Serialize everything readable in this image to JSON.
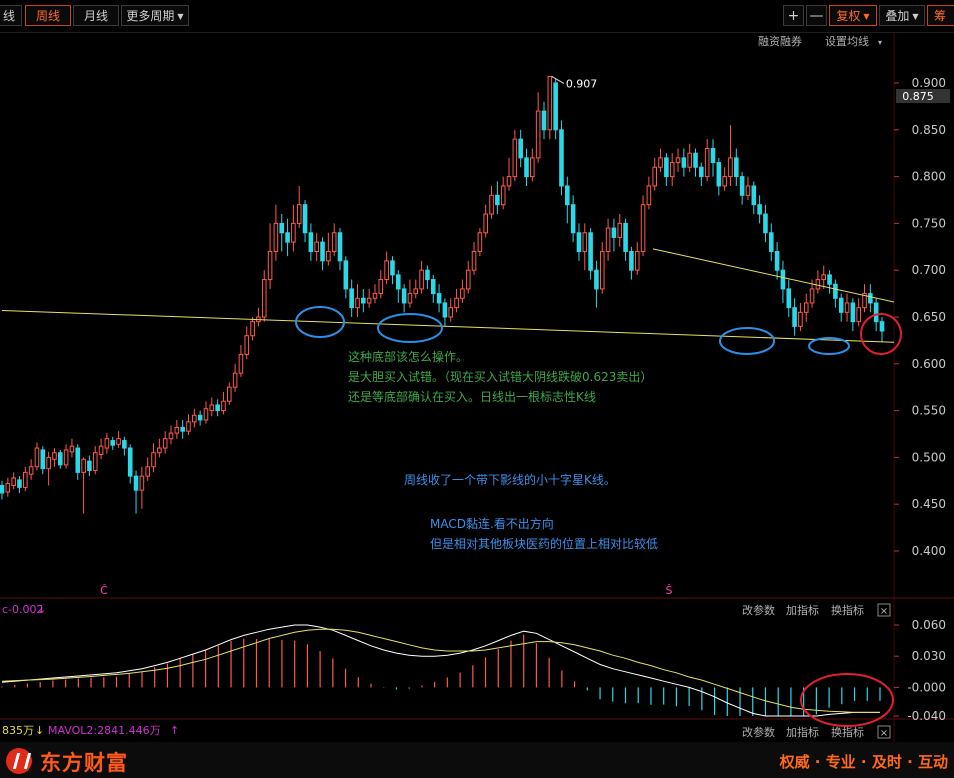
{
  "toolbar": {
    "cut_tab": "线",
    "tabs": [
      {
        "label": "周线",
        "active": true
      },
      {
        "label": "月线",
        "active": false
      },
      {
        "label": "更多周期",
        "active": false
      }
    ],
    "zoom_in": "+",
    "zoom_out": "—",
    "fuquan": "复权",
    "overlay": "叠加",
    "cut_right": "筹码"
  },
  "main_panel": {
    "links": [
      "融资融券",
      "设置均线"
    ],
    "current_price": "0.875",
    "price_ticks": [
      "0.900",
      "0.850",
      "0.800",
      "0.750",
      "0.700",
      "0.650",
      "0.600",
      "0.550",
      "0.500",
      "0.450",
      "0.400"
    ],
    "high_label": "0.907",
    "markers": [
      "Ĉ",
      "Ŝ"
    ],
    "annotations": [
      "这种底部该怎么操作。",
      "是大胆买入试错。（现在买入试错大阴线跌破0.623卖出）",
      "还是等底部确认在买入。日线出一根标志性K线",
      "周线收了一个带下影线的小十字星K线。",
      "MACD黏连.看不出方向",
      "但是相对其他板块医药的位置上相对比较低"
    ]
  },
  "macd_panel": {
    "label": "c-0.002",
    "links": [
      "改参数",
      "加指标",
      "换指标"
    ],
    "ticks": [
      "0.060",
      "0.030",
      "-0.000",
      "-0.040"
    ]
  },
  "vol_panel": {
    "label1": "835万",
    "label2": "MAVOL2:2841.446万",
    "links": [
      "改参数",
      "加指标",
      "换指标"
    ]
  },
  "brand": {
    "name": "东方财富",
    "slogan": "权威 · 专业 · 及时 · 互动"
  },
  "chart_data": {
    "type": "candlestick",
    "timeframe": "weekly",
    "ylim": [
      0.36,
      0.925
    ],
    "high_mark": 0.907,
    "current_price": 0.875,
    "candles": [
      [
        0.47,
        0.462,
        0.475,
        0.455
      ],
      [
        0.463,
        0.472,
        0.478,
        0.458
      ],
      [
        0.47,
        0.478,
        0.484,
        0.466
      ],
      [
        0.476,
        0.468,
        0.48,
        0.462
      ],
      [
        0.468,
        0.484,
        0.49,
        0.464
      ],
      [
        0.482,
        0.49,
        0.498,
        0.476
      ],
      [
        0.49,
        0.51,
        0.516,
        0.486
      ],
      [
        0.508,
        0.488,
        0.512,
        0.482
      ],
      [
        0.488,
        0.5,
        0.506,
        0.47
      ],
      [
        0.498,
        0.505,
        0.51,
        0.49
      ],
      [
        0.505,
        0.492,
        0.508,
        0.488
      ],
      [
        0.492,
        0.508,
        0.514,
        0.488
      ],
      [
        0.506,
        0.512,
        0.52,
        0.5
      ],
      [
        0.51,
        0.484,
        0.514,
        0.476
      ],
      [
        0.484,
        0.498,
        0.5,
        0.44
      ],
      [
        0.496,
        0.486,
        0.502,
        0.48
      ],
      [
        0.486,
        0.505,
        0.512,
        0.482
      ],
      [
        0.503,
        0.512,
        0.52,
        0.498
      ],
      [
        0.51,
        0.52,
        0.526,
        0.504
      ],
      [
        0.518,
        0.513,
        0.522,
        0.508
      ],
      [
        0.514,
        0.52,
        0.528,
        0.51
      ],
      [
        0.518,
        0.51,
        0.522,
        0.502
      ],
      [
        0.51,
        0.48,
        0.514,
        0.472
      ],
      [
        0.48,
        0.465,
        0.486,
        0.44
      ],
      [
        0.465,
        0.48,
        0.49,
        0.445
      ],
      [
        0.48,
        0.49,
        0.5,
        0.475
      ],
      [
        0.49,
        0.505,
        0.515,
        0.484
      ],
      [
        0.505,
        0.51,
        0.52,
        0.5
      ],
      [
        0.51,
        0.52,
        0.528,
        0.504
      ],
      [
        0.52,
        0.526,
        0.534,
        0.514
      ],
      [
        0.526,
        0.532,
        0.54,
        0.52
      ],
      [
        0.532,
        0.528,
        0.54,
        0.52
      ],
      [
        0.528,
        0.538,
        0.546,
        0.524
      ],
      [
        0.538,
        0.545,
        0.552,
        0.532
      ],
      [
        0.545,
        0.54,
        0.55,
        0.534
      ],
      [
        0.54,
        0.552,
        0.56,
        0.536
      ],
      [
        0.55,
        0.556,
        0.564,
        0.544
      ],
      [
        0.556,
        0.55,
        0.562,
        0.544
      ],
      [
        0.55,
        0.56,
        0.57,
        0.546
      ],
      [
        0.56,
        0.575,
        0.58,
        0.556
      ],
      [
        0.575,
        0.59,
        0.6,
        0.57
      ],
      [
        0.59,
        0.61,
        0.62,
        0.586
      ],
      [
        0.61,
        0.63,
        0.64,
        0.605
      ],
      [
        0.63,
        0.645,
        0.65,
        0.625
      ],
      [
        0.645,
        0.65,
        0.66,
        0.64
      ],
      [
        0.65,
        0.69,
        0.7,
        0.645
      ],
      [
        0.69,
        0.72,
        0.75,
        0.68
      ],
      [
        0.72,
        0.75,
        0.77,
        0.71
      ],
      [
        0.75,
        0.74,
        0.76,
        0.72
      ],
      [
        0.74,
        0.73,
        0.755,
        0.715
      ],
      [
        0.73,
        0.75,
        0.77,
        0.72
      ],
      [
        0.75,
        0.77,
        0.79,
        0.745
      ],
      [
        0.77,
        0.74,
        0.775,
        0.73
      ],
      [
        0.74,
        0.72,
        0.75,
        0.71
      ],
      [
        0.72,
        0.73,
        0.74,
        0.71
      ],
      [
        0.73,
        0.71,
        0.735,
        0.7
      ],
      [
        0.71,
        0.72,
        0.74,
        0.705
      ],
      [
        0.72,
        0.74,
        0.75,
        0.715
      ],
      [
        0.74,
        0.71,
        0.745,
        0.7
      ],
      [
        0.71,
        0.68,
        0.715,
        0.67
      ],
      [
        0.68,
        0.66,
        0.69,
        0.65
      ],
      [
        0.66,
        0.67,
        0.685,
        0.65
      ],
      [
        0.67,
        0.665,
        0.68,
        0.655
      ],
      [
        0.665,
        0.67,
        0.68,
        0.66
      ],
      [
        0.67,
        0.675,
        0.685,
        0.665
      ],
      [
        0.675,
        0.69,
        0.7,
        0.67
      ],
      [
        0.69,
        0.71,
        0.72,
        0.685
      ],
      [
        0.71,
        0.695,
        0.715,
        0.685
      ],
      [
        0.695,
        0.68,
        0.7,
        0.665
      ],
      [
        0.68,
        0.665,
        0.685,
        0.655
      ],
      [
        0.665,
        0.675,
        0.69,
        0.66
      ],
      [
        0.675,
        0.68,
        0.69,
        0.67
      ],
      [
        0.68,
        0.7,
        0.71,
        0.675
      ],
      [
        0.7,
        0.69,
        0.705,
        0.68
      ],
      [
        0.69,
        0.675,
        0.695,
        0.665
      ],
      [
        0.675,
        0.665,
        0.685,
        0.655
      ],
      [
        0.665,
        0.65,
        0.67,
        0.64
      ],
      [
        0.65,
        0.66,
        0.67,
        0.645
      ],
      [
        0.66,
        0.67,
        0.68,
        0.655
      ],
      [
        0.67,
        0.68,
        0.69,
        0.665
      ],
      [
        0.68,
        0.7,
        0.71,
        0.675
      ],
      [
        0.7,
        0.72,
        0.73,
        0.695
      ],
      [
        0.72,
        0.74,
        0.745,
        0.715
      ],
      [
        0.74,
        0.76,
        0.77,
        0.735
      ],
      [
        0.76,
        0.78,
        0.79,
        0.755
      ],
      [
        0.78,
        0.77,
        0.795,
        0.76
      ],
      [
        0.77,
        0.79,
        0.8,
        0.765
      ],
      [
        0.79,
        0.8,
        0.82,
        0.785
      ],
      [
        0.8,
        0.84,
        0.85,
        0.795
      ],
      [
        0.84,
        0.82,
        0.85,
        0.81
      ],
      [
        0.82,
        0.8,
        0.83,
        0.79
      ],
      [
        0.8,
        0.82,
        0.83,
        0.795
      ],
      [
        0.82,
        0.87,
        0.89,
        0.815
      ],
      [
        0.87,
        0.85,
        0.88,
        0.84
      ],
      [
        0.85,
        0.907,
        0.907,
        0.84
      ],
      [
        0.9,
        0.85,
        0.905,
        0.84
      ],
      [
        0.85,
        0.79,
        0.86,
        0.78
      ],
      [
        0.79,
        0.77,
        0.8,
        0.75
      ],
      [
        0.77,
        0.74,
        0.78,
        0.73
      ],
      [
        0.74,
        0.72,
        0.75,
        0.71
      ],
      [
        0.72,
        0.74,
        0.75,
        0.7
      ],
      [
        0.74,
        0.7,
        0.745,
        0.69
      ],
      [
        0.7,
        0.68,
        0.71,
        0.66
      ],
      [
        0.68,
        0.72,
        0.73,
        0.675
      ],
      [
        0.72,
        0.745,
        0.755,
        0.71
      ],
      [
        0.745,
        0.735,
        0.755,
        0.72
      ],
      [
        0.735,
        0.75,
        0.76,
        0.725
      ],
      [
        0.75,
        0.72,
        0.755,
        0.71
      ],
      [
        0.72,
        0.7,
        0.725,
        0.69
      ],
      [
        0.7,
        0.72,
        0.73,
        0.695
      ],
      [
        0.72,
        0.77,
        0.78,
        0.715
      ],
      [
        0.77,
        0.79,
        0.8,
        0.765
      ],
      [
        0.79,
        0.81,
        0.82,
        0.785
      ],
      [
        0.81,
        0.82,
        0.83,
        0.805
      ],
      [
        0.82,
        0.8,
        0.825,
        0.79
      ],
      [
        0.8,
        0.815,
        0.825,
        0.79
      ],
      [
        0.815,
        0.82,
        0.83,
        0.805
      ],
      [
        0.82,
        0.81,
        0.83,
        0.8
      ],
      [
        0.81,
        0.825,
        0.835,
        0.805
      ],
      [
        0.825,
        0.81,
        0.83,
        0.8
      ],
      [
        0.81,
        0.8,
        0.815,
        0.79
      ],
      [
        0.8,
        0.83,
        0.84,
        0.795
      ],
      [
        0.83,
        0.815,
        0.84,
        0.8
      ],
      [
        0.815,
        0.79,
        0.82,
        0.78
      ],
      [
        0.79,
        0.8,
        0.81,
        0.785
      ],
      [
        0.8,
        0.82,
        0.855,
        0.79
      ],
      [
        0.82,
        0.8,
        0.83,
        0.79
      ],
      [
        0.8,
        0.78,
        0.805,
        0.77
      ],
      [
        0.78,
        0.79,
        0.8,
        0.775
      ],
      [
        0.79,
        0.77,
        0.795,
        0.76
      ],
      [
        0.77,
        0.76,
        0.78,
        0.75
      ],
      [
        0.76,
        0.74,
        0.77,
        0.73
      ],
      [
        0.74,
        0.72,
        0.75,
        0.71
      ],
      [
        0.72,
        0.7,
        0.73,
        0.69
      ],
      [
        0.7,
        0.68,
        0.71,
        0.665
      ],
      [
        0.68,
        0.66,
        0.69,
        0.65
      ],
      [
        0.66,
        0.64,
        0.67,
        0.63
      ],
      [
        0.64,
        0.655,
        0.665,
        0.635
      ],
      [
        0.655,
        0.665,
        0.675,
        0.645
      ],
      [
        0.665,
        0.68,
        0.69,
        0.66
      ],
      [
        0.68,
        0.69,
        0.7,
        0.675
      ],
      [
        0.69,
        0.695,
        0.705,
        0.68
      ],
      [
        0.695,
        0.685,
        0.7,
        0.675
      ],
      [
        0.685,
        0.67,
        0.69,
        0.66
      ],
      [
        0.67,
        0.655,
        0.675,
        0.645
      ],
      [
        0.655,
        0.665,
        0.675,
        0.645
      ],
      [
        0.665,
        0.645,
        0.67,
        0.635
      ],
      [
        0.645,
        0.66,
        0.67,
        0.64
      ],
      [
        0.66,
        0.675,
        0.685,
        0.655
      ],
      [
        0.675,
        0.665,
        0.685,
        0.655
      ],
      [
        0.665,
        0.645,
        0.67,
        0.635
      ],
      [
        0.645,
        0.635,
        0.65,
        0.623
      ]
    ],
    "support_line": [
      [
        0,
        0.657
      ],
      [
        147,
        0.623
      ]
    ],
    "resistance_line": [
      [
        134,
        0.71
      ],
      [
        147,
        0.666
      ]
    ],
    "macd": {
      "ylim": [
        -0.05,
        0.07
      ],
      "dif": [
        0.005,
        0.006,
        0.007,
        0.008,
        0.009,
        0.01,
        0.011,
        0.012,
        0.013,
        0.014,
        0.016,
        0.018,
        0.021,
        0.024,
        0.028,
        0.032,
        0.036,
        0.041,
        0.046,
        0.05,
        0.053,
        0.056,
        0.058,
        0.06,
        0.06,
        0.058,
        0.055,
        0.05,
        0.045,
        0.04,
        0.036,
        0.033,
        0.031,
        0.03,
        0.03,
        0.031,
        0.033,
        0.036,
        0.04,
        0.045,
        0.05,
        0.054,
        0.052,
        0.046,
        0.04,
        0.034,
        0.028,
        0.022,
        0.018,
        0.015,
        0.012,
        0.009,
        0.006,
        0.003,
        0.0,
        -0.004,
        -0.009,
        -0.015,
        -0.02,
        -0.025,
        -0.028,
        -0.03,
        -0.031,
        -0.03,
        -0.028,
        -0.026,
        -0.025,
        -0.024,
        -0.024,
        -0.024
      ],
      "dea": [
        0.006,
        0.0065,
        0.007,
        0.0075,
        0.008,
        0.0088,
        0.0096,
        0.0105,
        0.0115,
        0.0125,
        0.0135,
        0.015,
        0.0165,
        0.0185,
        0.021,
        0.024,
        0.027,
        0.031,
        0.035,
        0.039,
        0.043,
        0.047,
        0.05,
        0.053,
        0.055,
        0.056,
        0.056,
        0.055,
        0.053,
        0.05,
        0.047,
        0.044,
        0.041,
        0.038,
        0.036,
        0.035,
        0.035,
        0.035,
        0.036,
        0.038,
        0.04,
        0.042,
        0.044,
        0.044,
        0.043,
        0.041,
        0.038,
        0.035,
        0.031,
        0.028,
        0.024,
        0.021,
        0.017,
        0.014,
        0.01,
        0.007,
        0.003,
        -0.001,
        -0.005,
        -0.009,
        -0.013,
        -0.016,
        -0.019,
        -0.021,
        -0.022,
        -0.023,
        -0.0235,
        -0.024,
        -0.024,
        -0.024
      ]
    }
  }
}
